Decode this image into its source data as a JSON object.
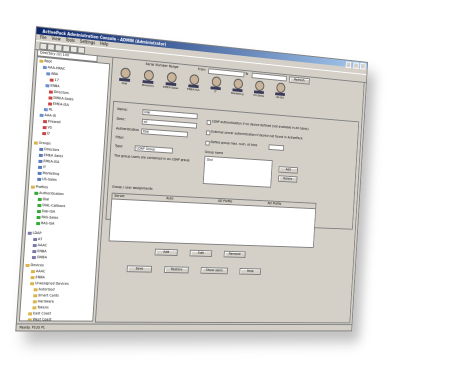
{
  "window": {
    "title": "ActivePack Administration Console - ADMIN (Administrator)"
  },
  "menu": [
    "File",
    "View",
    "Tools",
    "Settings",
    "Help"
  ],
  "directory": {
    "label": "Directory",
    "value": "(U) 100",
    "value2": "Users"
  },
  "tree": [
    "Root",
    "AAA-HRAC",
    "ABA",
    "17",
    "ENBA",
    "Directors",
    "DIREA-Sales",
    "EMEA-ISA",
    "RL",
    "AAA-IX",
    "Firewall",
    "VS",
    "D",
    "Groups",
    "Directors",
    "EMEA Sales",
    "EMEA-ISA",
    "IT",
    "Marketing",
    "US-Sales",
    "Profiles",
    "Authentication",
    "Dial",
    "DIAL-Callback",
    "Dial-ISA",
    "RAS-Sales",
    "RAS-ISA",
    "LDAP",
    "AT",
    "AAAC",
    "ENBA",
    "SWBA",
    "Groups",
    "AAAC",
    "Unassigned Devices",
    "Autorized",
    "Smart Cards",
    "Hardware",
    "Tokens",
    "East Coast",
    "West Coast",
    "Devices"
  ],
  "topbar": {
    "group_range": "Serial Number Range",
    "from_label": "From",
    "to_label": "To",
    "refresh": "Refresh"
  },
  "avatars": [
    "Dial",
    "Directors",
    "EMEA-Sales",
    "EMEA-ISA",
    "IT",
    "Marketing",
    "US-Sales",
    "US-ISA"
  ],
  "form": {
    "name_label": "Name:",
    "name_value": "Dial",
    "desc_label": "Desc:",
    "desc_value": "all",
    "auth_label": "Authentication",
    "auth_value": "Dial",
    "filter_label": "Filter:",
    "type_label": "Type:",
    "type_value": "LDAP Group",
    "info_text": "The group users are contained in an LDAP group",
    "group_name_label": "Group name",
    "group_name_value": "Dial",
    "chk1": "LDAP authentication if no device defined (not available in all cases)",
    "chk2": "External server authentication if device not found in ActivePack",
    "chk3": "Define group max. num. of tries",
    "add_btn": "Add",
    "delete_btn": "Delete"
  },
  "assignments": {
    "title": "Group / user assignments",
    "cols": [
      "Server",
      "Auto",
      "AD Profile",
      "AD Profile"
    ],
    "add": "Add",
    "edit": "Edit",
    "remove": "Remove"
  },
  "bottom_buttons": [
    "Save",
    "Restore",
    "Show users",
    "Help"
  ],
  "status": "Ready. PLUS PL"
}
